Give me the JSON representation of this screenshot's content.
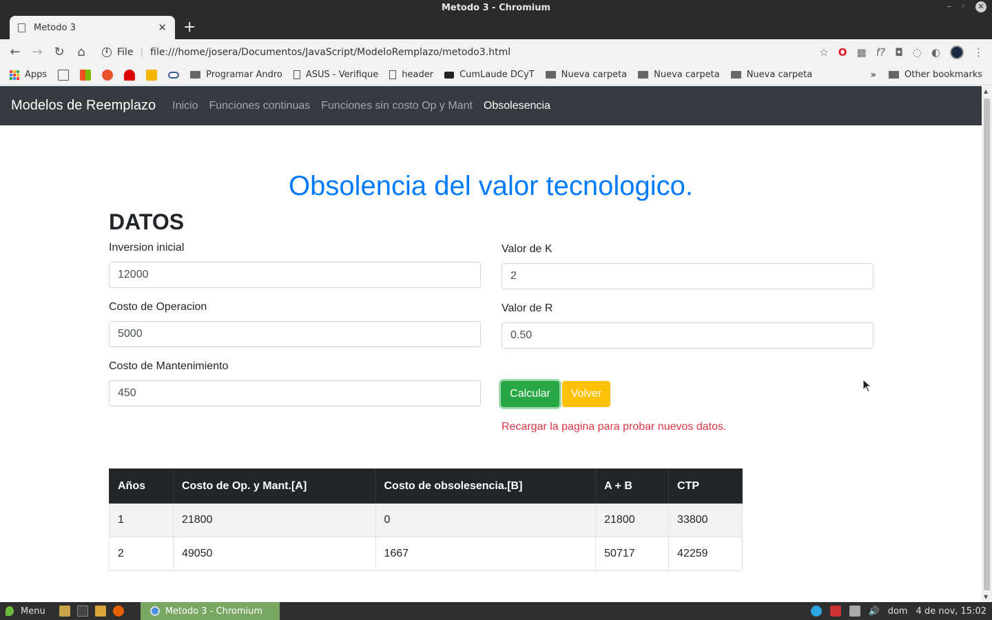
{
  "window": {
    "title": "Metodo 3 - Chromium",
    "tab_label": "Metodo 3",
    "url_scheme": "File",
    "url": "file:///home/josera/Documentos/JavaScript/ModeloRemplazo/metodo3.html"
  },
  "bookmarks": {
    "apps": "Apps",
    "items": [
      "Programar Andro",
      "ASUS - Verifique",
      "header",
      "CumLaude DCyT",
      "Nueva carpeta",
      "Nueva carpeta",
      "Nueva carpeta"
    ],
    "more": "»",
    "other": "Other bookmarks"
  },
  "navbar": {
    "brand": "Modelos de Reemplazo",
    "links": [
      "Inicio",
      "Funciones continuas",
      "Funciones sin costo Op y Mant",
      "Obsolesencia"
    ]
  },
  "page": {
    "title": "Obsolencia del valor tecnologico.",
    "section": "DATOS",
    "fields": {
      "inversion": {
        "label": "Inversion inicial",
        "value": "12000"
      },
      "operacion": {
        "label": "Costo de Operacion",
        "value": "5000"
      },
      "mantenimiento": {
        "label": "Costo de Mantenimiento",
        "value": "450"
      },
      "k": {
        "label": "Valor de K",
        "value": "2"
      },
      "r": {
        "label": "Valor de R",
        "value": "0.50"
      }
    },
    "buttons": {
      "calcular": "Calcular",
      "volver": "Volver"
    },
    "warning": "Recargar la pagina para probar nuevos datos."
  },
  "table": {
    "headers": [
      "Años",
      "Costo de Op. y Mant.[A]",
      "Costo de obsolesencia.[B]",
      "A + B",
      "CTP"
    ],
    "rows": [
      [
        "1",
        "21800",
        "0",
        "21800",
        "33800"
      ],
      [
        "2",
        "49050",
        "1667",
        "50717",
        "42259"
      ]
    ]
  },
  "taskbar": {
    "menu": "Menu",
    "task": "Metodo 3 - Chromium",
    "day": "dom",
    "datetime": "4 de nov, 15:02"
  },
  "colors": {
    "primary": "#007bff",
    "success": "#28a745",
    "warning": "#ffc107",
    "danger": "#dc3545",
    "navbar": "#343a40"
  }
}
